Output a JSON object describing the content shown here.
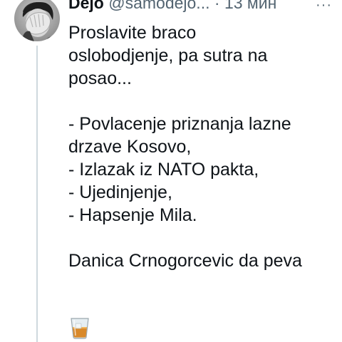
{
  "tweet": {
    "author_name": "Dejo",
    "handle": "@samodejo...",
    "separator": "·",
    "time": "13 мин",
    "lines_top": [
      "Proslavite braco",
      "oslobodjenje, pa sutra na",
      "posao..."
    ],
    "lines_list": [
      "- Povlacenje priznanja lazne",
      "drzave Kosovo,",
      "- Izlazak iz NATO pakta,",
      "- Ujedinjenje,",
      "- Hapsenje Mila."
    ],
    "line_bottom": "Danica Crnogorcevic da peva",
    "emoji": "tumbler-glass-emoji"
  },
  "colors": {
    "text": "#0f1419",
    "secondary": "#536471",
    "thread_line": "#cfd9de",
    "background": "#ffffff"
  }
}
